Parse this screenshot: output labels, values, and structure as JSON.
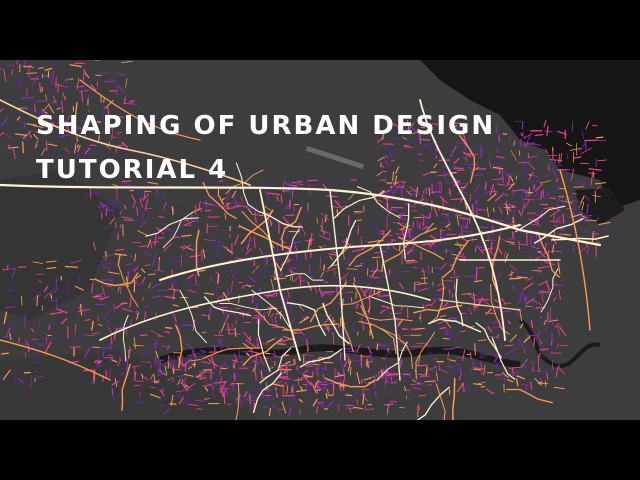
{
  "title": {
    "line1": "SHAPING OF URBAN DESIGN",
    "line2": "TUTORIAL 4"
  },
  "colors": {
    "land": "#3d3d3d",
    "land_dark": "#323232",
    "water": "#161616",
    "road_major": "#fff3cf",
    "road_orange": "#ff9a52",
    "road_pink": "#ec3f8f",
    "road_purple": "#8a2bb8",
    "road_violet": "#5a2a9a",
    "letterbox": "#000000"
  },
  "map": {
    "content": "street network visualization",
    "style": "dark basemap with color-graded streets"
  }
}
